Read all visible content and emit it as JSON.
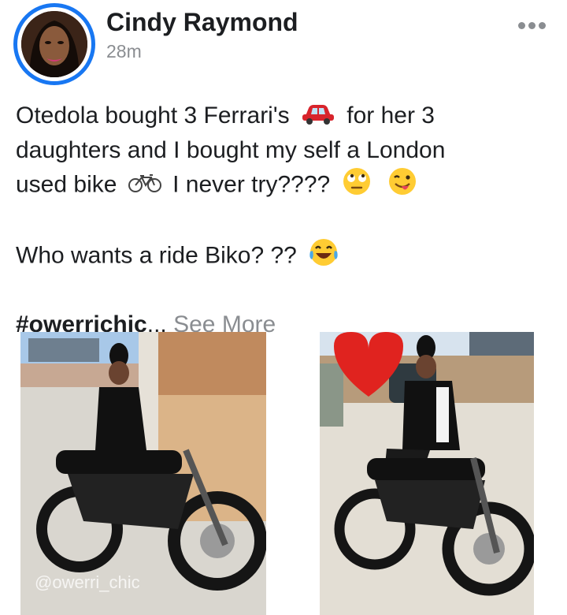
{
  "post": {
    "author": "Cindy Raymond",
    "time": "28m",
    "line1_a": "Otedola bought 3 Ferrari's",
    "line1_b": "for her 3",
    "line2": "daughters and I bought my self a London",
    "line3_a": "used bike",
    "line3_b": "I never try????",
    "line4": "Who wants a ride Biko? ??",
    "hashtag": "#owerrichic",
    "ellipsis": "...",
    "see_more": "See More"
  },
  "icons": {
    "car": "red-car-emoji",
    "bike": "bicycle-emoji",
    "eyeroll": "face-with-rolling-eyes-emoji",
    "wink_tongue": "winking-face-with-tongue-emoji",
    "tears_joy": "face-with-tears-of-joy-emoji",
    "more": "more-options-icon"
  },
  "photos": {
    "watermark": "@owerri_chic"
  },
  "colors": {
    "avatar_ring": "#1877f2",
    "secondary_text": "#8a8d91"
  }
}
